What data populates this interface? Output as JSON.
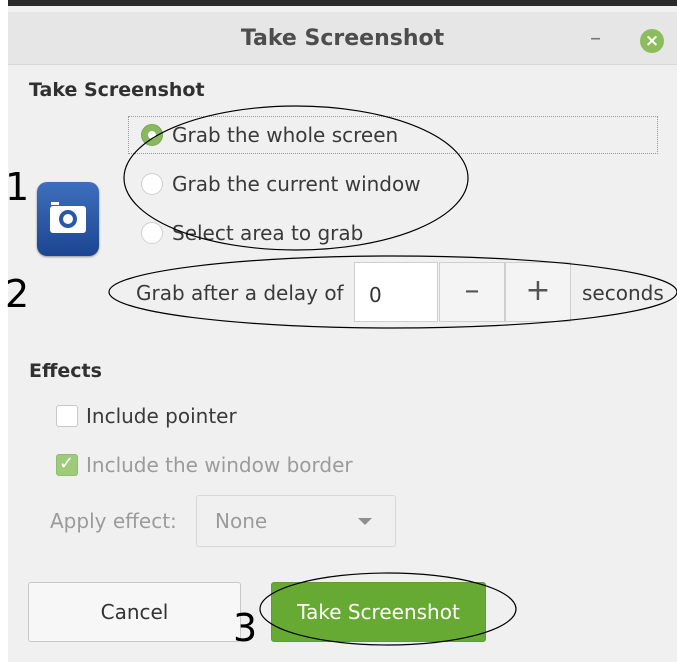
{
  "window": {
    "title": "Take Screenshot",
    "minimize_label": "–",
    "close_label": "×"
  },
  "take_screenshot": {
    "heading": "Take Screenshot",
    "options": [
      {
        "label": "Grab the whole screen",
        "selected": true
      },
      {
        "label": "Grab the current window",
        "selected": false
      },
      {
        "label": "Select area to grab",
        "selected": false
      }
    ],
    "delay": {
      "prefix": "Grab after a delay of",
      "value": "0",
      "minus": "–",
      "plus": "+",
      "suffix": "seconds"
    }
  },
  "effects": {
    "heading": "Effects",
    "include_pointer": {
      "label": "Include pointer",
      "checked": false
    },
    "include_border": {
      "label": "Include the window border",
      "checked": true,
      "disabled": true
    },
    "apply_effect": {
      "label": "Apply effect:",
      "value": "None"
    }
  },
  "buttons": {
    "cancel": "Cancel",
    "take": "Take Screenshot"
  },
  "annotations": [
    "1",
    "2",
    "3"
  ],
  "colors": {
    "accent": "#66aa33",
    "radio_selected": "#8ab860",
    "icon_blue": "#2a58a8"
  }
}
